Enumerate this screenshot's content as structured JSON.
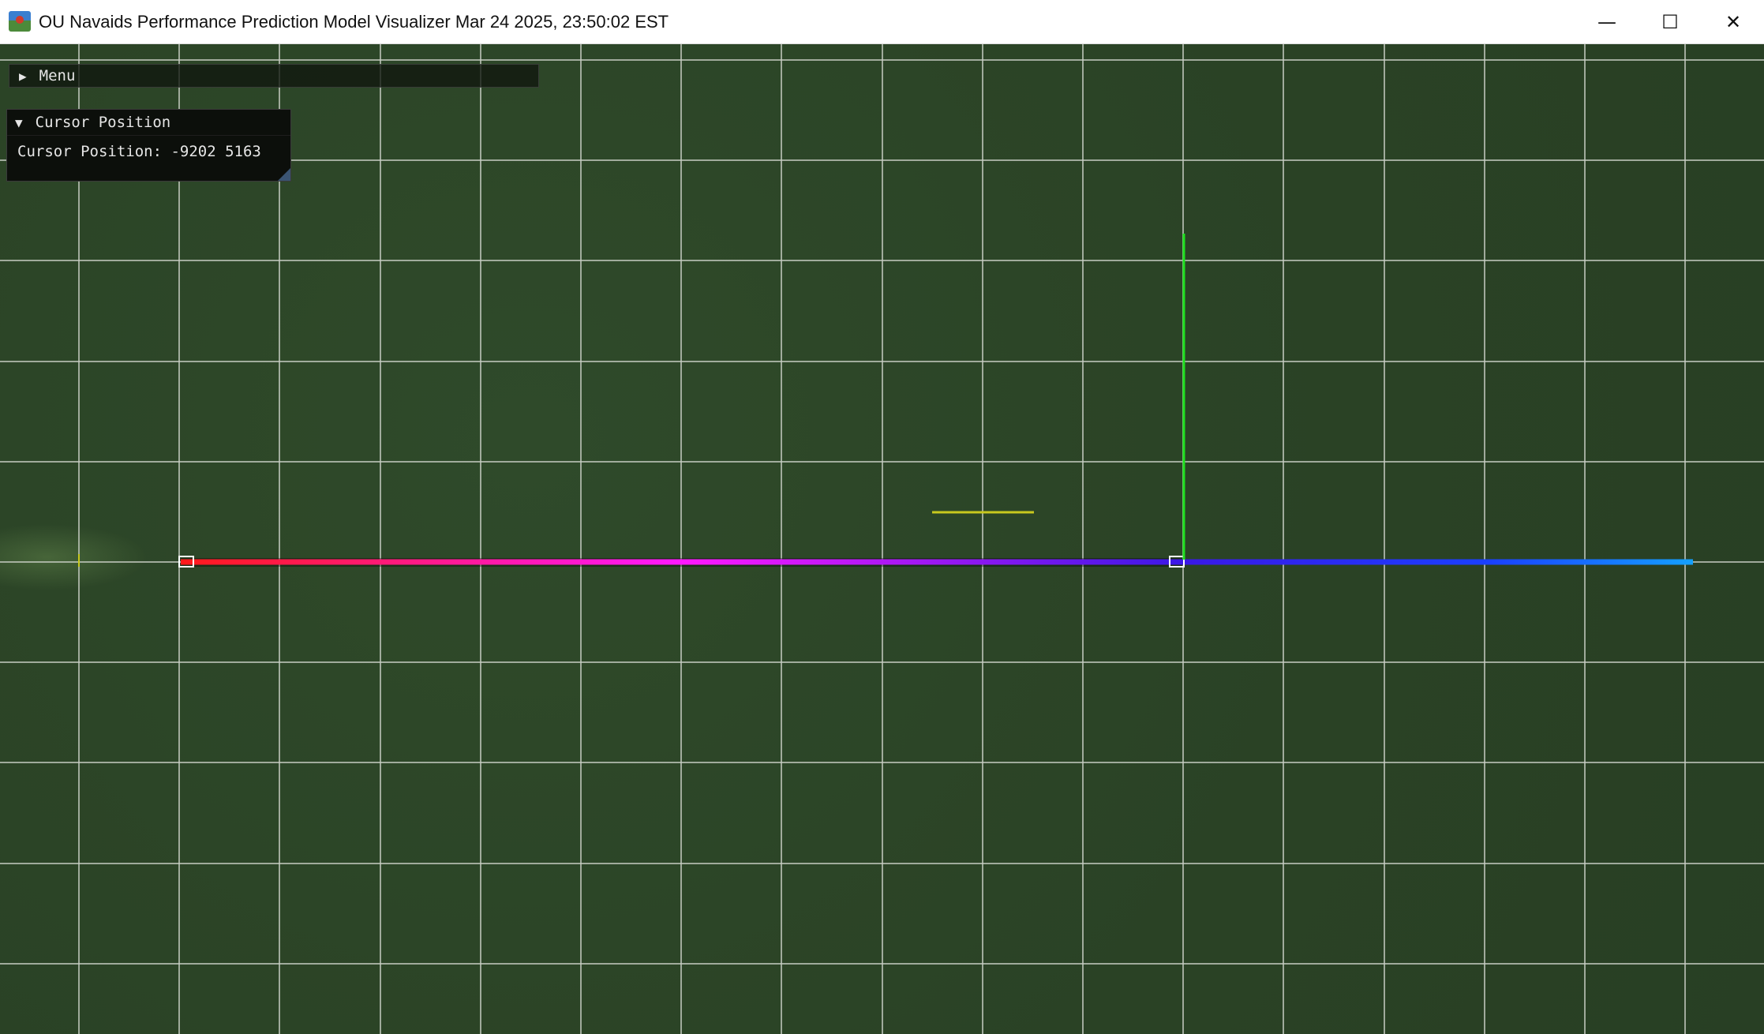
{
  "window": {
    "title": "OU Navaids Performance Prediction Model Visualizer Mar 24 2025, 23:50:02 EST",
    "minimize_icon": "minimize-icon",
    "maximize_icon": "maximize-icon",
    "close_icon": "close-icon",
    "minimize_glyph": "—",
    "maximize_glyph": "☐",
    "close_glyph": "✕"
  },
  "menu": {
    "arrow_glyph": "▶",
    "label": "Menu"
  },
  "cursor_panel": {
    "arrow_glyph": "▼",
    "header": "Cursor Position",
    "text": "Cursor Position: -9202 5163"
  },
  "scene": {
    "colors": {
      "ground": "#2c4427",
      "grid": "#c8cdc4",
      "runway_start": "#ff1a1a",
      "runway_mid": "#ff19ff",
      "runway_join": "#3a18e6",
      "runway_end": "#14a0ff",
      "vertical_axis": "#1ee01e",
      "marker": "#c8c81e"
    }
  }
}
